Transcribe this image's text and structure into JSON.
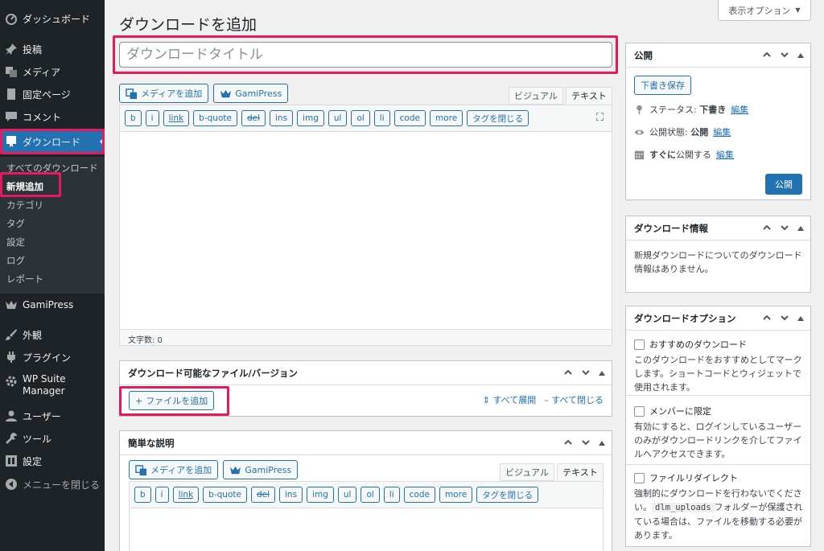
{
  "sidebar": {
    "dashboard": "ダッシュボード",
    "posts": "投稿",
    "media": "メディア",
    "pages": "固定ページ",
    "comments": "コメント",
    "downloads": "ダウンロード",
    "submenu": [
      "すべてのダウンロード",
      "新規追加",
      "カテゴリ",
      "タグ",
      "設定",
      "ログ",
      "レポート"
    ],
    "gamipress": "GamiPress",
    "appearance": "外観",
    "plugins": "プラグイン",
    "wpsuite_line1": "WP Suite",
    "wpsuite_line2": "Manager",
    "users": "ユーザー",
    "tools": "ツール",
    "settings": "設定",
    "collapse": "メニューを閉じる"
  },
  "header": {
    "screen_options": "表示オプション",
    "page_title": "ダウンロードを追加",
    "title_placeholder": "ダウンロードタイトル"
  },
  "editor": {
    "add_media": "メディアを追加",
    "gamipress": "GamiPress",
    "tab_visual": "ビジュアル",
    "tab_text": "テキスト",
    "quicktags": [
      "b",
      "i",
      "link",
      "b-quote",
      "del",
      "ins",
      "img",
      "ul",
      "ol",
      "li",
      "code",
      "more",
      "タグを閉じる"
    ],
    "word_count": "文字数: 0"
  },
  "files_box": {
    "title": "ダウンロード可能なファイル/バージョン",
    "add_file": "ファイルを追加",
    "expand_all": "すべて展開",
    "close_all": "すべて閉じる"
  },
  "short_desc": {
    "title": "簡単な説明"
  },
  "publish": {
    "title": "公開",
    "save_draft": "下書き保存",
    "status_label": "ステータス: ",
    "status_value": "下書き",
    "visibility_label": "公開状態: ",
    "visibility_value": "公開",
    "schedule_label": "すぐに",
    "schedule_suffix": "公開する",
    "edit": "編集",
    "publish_button": "公開"
  },
  "download_info": {
    "title": "ダウンロード情報",
    "text": "新規ダウンロードについてのダウンロード情報はありません。"
  },
  "download_options": {
    "title": "ダウンロードオプション",
    "featured_label": "おすすめのダウンロード",
    "featured_desc": "このダウンロードをおすすめとしてマークします。ショートコードとウィジェットで使用されます。",
    "members_label": "メンバーに限定",
    "members_desc": "有効にすると、ログインしているユーザーのみがダウンロードリンクを介してファイルへアクセスできます。",
    "redirect_label": "ファイルリダイレクト",
    "redirect_desc_1": "強制的にダウンロードを行わないでください。",
    "redirect_code": "dlm_uploads",
    "redirect_desc_2": "フォルダーが保護されている場合は、ファイルを移動する必要があります。"
  },
  "colors": {
    "admin_bar": "#1d2327",
    "accent": "#2271b1",
    "highlight": "#e6195c"
  }
}
